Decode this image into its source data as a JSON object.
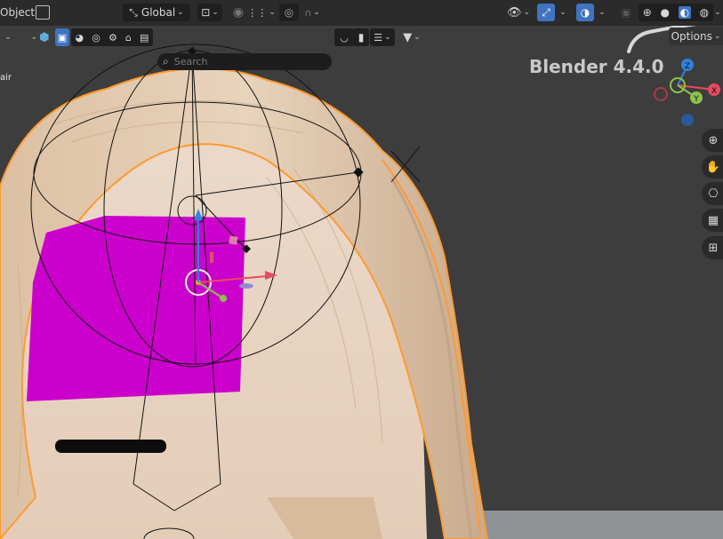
{
  "header": {
    "mode_label": "Object",
    "orientation_label": "Global"
  },
  "toolbar": {
    "search_placeholder": "Search",
    "options_label": "Options"
  },
  "viewport": {
    "version_label": "Blender 4.4.0",
    "collection_label": "air"
  },
  "gizmo": {
    "z_label": "Z",
    "x_label": "X",
    "y_label": "Y"
  },
  "colors": {
    "header_bg": "#2b2b2b",
    "accent_blue": "#3f74c2",
    "face_mesh": "#cc00cc",
    "selection_outline": "#ff9a30",
    "axis_x": "#e84a5f",
    "axis_y": "#8bc34a",
    "axis_z": "#2f82e0"
  },
  "icons": [
    "object-mode-icon",
    "transform-orientation-icon",
    "pivot-icon",
    "snap-icon",
    "proportional-editing-icon",
    "visibility-icon",
    "gizmo-icon",
    "overlay-icon",
    "xray-icon",
    "shading-wireframe-icon",
    "shading-solid-icon",
    "shading-material-icon",
    "shading-rendered-icon",
    "zoom-icon",
    "pan-hand-icon",
    "camera-icon",
    "ortho-grid-icon",
    "local-view-icon"
  ]
}
